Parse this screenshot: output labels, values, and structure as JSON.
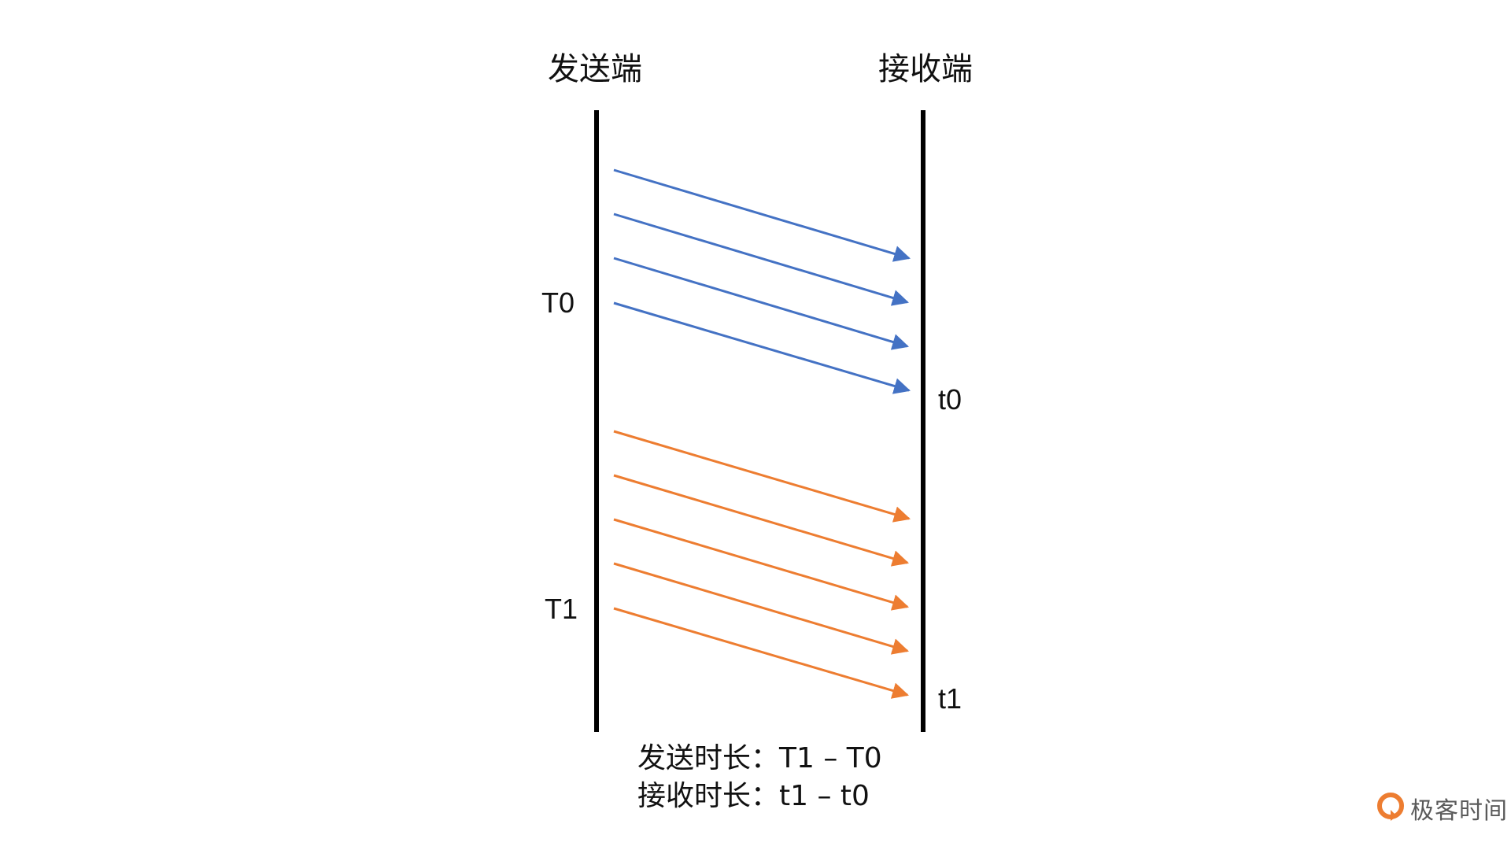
{
  "headers": {
    "sender": "发送端",
    "receiver": "接收端"
  },
  "markers": {
    "T0": "T0",
    "T1": "T1",
    "t0": "t0",
    "t1": "t1"
  },
  "summary": {
    "send_line": "发送时长：T1 – T0",
    "recv_line": "接收时长：t1 – t0"
  },
  "colors": {
    "timeline": "#000000",
    "first_batch": "#4472c4",
    "second_batch": "#ed7d31",
    "brand": "#ed7d31"
  },
  "arrows": {
    "first_batch_count": 4,
    "second_batch_count": 5
  },
  "brand": {
    "icon": "geektime-logo-icon",
    "text": "极客时间"
  }
}
